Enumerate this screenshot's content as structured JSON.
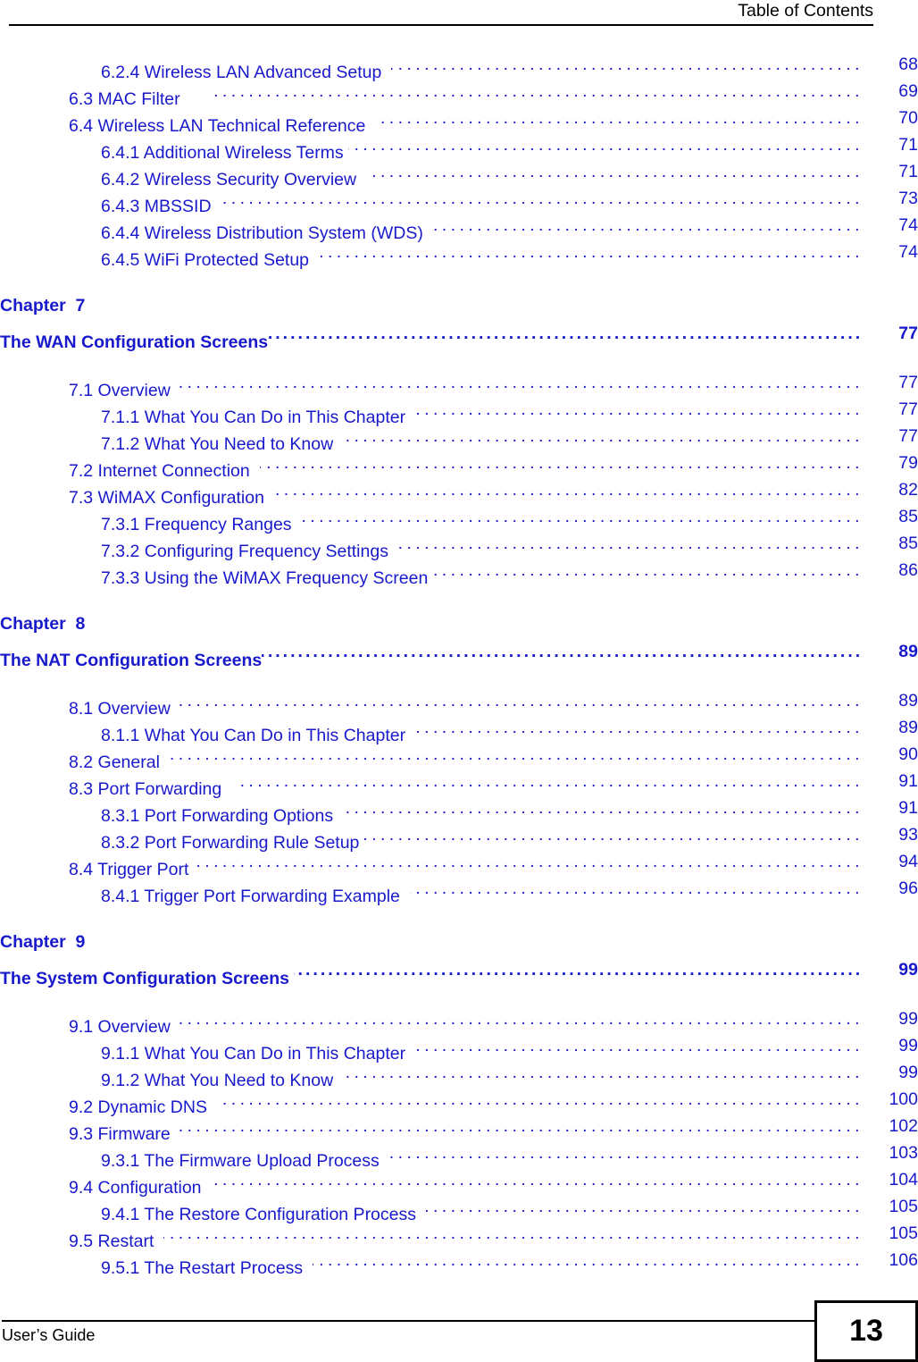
{
  "header": {
    "title": "Table of Contents"
  },
  "footer": {
    "left_text": "User’s Guide",
    "page_number": "13"
  },
  "colors": {
    "link_blue": "#1919cc",
    "text_black": "#000000",
    "page_background": "#ffffff"
  },
  "toc": {
    "groups": [
      {
        "type": "entries",
        "entries": [
          {
            "level": 3,
            "label": "6.2.4 Wireless LAN Advanced Setup  ",
            "page": "68"
          },
          {
            "level": 2,
            "label": "6.3 MAC Filter      ",
            "page": "69"
          },
          {
            "level": 2,
            "label": "6.4 Wireless LAN Technical Reference  ",
            "page": "70"
          },
          {
            "level": 3,
            "label": "6.4.1 Additional Wireless Terms ",
            "page": "71"
          },
          {
            "level": 3,
            "label": "6.4.2 Wireless Security Overview  ",
            "page": "71"
          },
          {
            "level": 3,
            "label": "6.4.3 MBSSID  ",
            "page": "73"
          },
          {
            "level": 3,
            "label": "6.4.4 Wireless Distribution System (WDS) ",
            "page": "74"
          },
          {
            "level": 3,
            "label": "6.4.5 WiFi Protected Setup  ",
            "page": "74"
          }
        ]
      },
      {
        "type": "chapter",
        "chapter_label": "Chapter  7",
        "chapter_title": "The WAN Configuration Screens",
        "chapter_page": "77",
        "entries": [
          {
            "level": 2,
            "label": "7.1 Overview ",
            "page": "77"
          },
          {
            "level": 3,
            "label": "7.1.1 What You Can Do in This Chapter  ",
            "page": "77"
          },
          {
            "level": 3,
            "label": "7.1.2 What You Need to Know  ",
            "page": "77"
          },
          {
            "level": 2,
            "label": "7.2 Internet Connection  ",
            "page": "79"
          },
          {
            "level": 2,
            "label": "7.3 WiMAX Configuration  ",
            "page": "82"
          },
          {
            "level": 3,
            "label": "7.3.1 Frequency Ranges ",
            "page": "85"
          },
          {
            "level": 3,
            "label": "7.3.2 Configuring Frequency Settings ",
            "page": "85"
          },
          {
            "level": 3,
            "label": "7.3.3 Using the WiMAX Frequency Screen ",
            "page": "86"
          }
        ]
      },
      {
        "type": "chapter",
        "chapter_label": "Chapter  8",
        "chapter_title": "The NAT Configuration Screens",
        "chapter_page": "89",
        "entries": [
          {
            "level": 2,
            "label": "8.1 Overview ",
            "page": "89"
          },
          {
            "level": 3,
            "label": "8.1.1 What You Can Do in This Chapter  ",
            "page": "89"
          },
          {
            "level": 2,
            "label": "8.2 General ",
            "page": "90"
          },
          {
            "level": 2,
            "label": "8.3 Port Forwarding   ",
            "page": "91"
          },
          {
            "level": 3,
            "label": "8.3.1 Port Forwarding Options  ",
            "page": "91"
          },
          {
            "level": 3,
            "label": "8.3.2 Port Forwarding Rule Setup ",
            "page": "93"
          },
          {
            "level": 2,
            "label": "8.4 Trigger Port ",
            "page": "94"
          },
          {
            "level": 3,
            "label": "8.4.1 Trigger Port Forwarding Example  ",
            "page": "96"
          }
        ]
      },
      {
        "type": "chapter",
        "chapter_label": "Chapter  9",
        "chapter_title": "The System Configuration Screens ",
        "chapter_page": "99",
        "entries": [
          {
            "level": 2,
            "label": "9.1 Overview ",
            "page": "99"
          },
          {
            "level": 3,
            "label": "9.1.1 What You Can Do in This Chapter  ",
            "page": "99"
          },
          {
            "level": 3,
            "label": "9.1.2 What You Need to Know  ",
            "page": "99"
          },
          {
            "level": 2,
            "label": "9.2 Dynamic DNS  ",
            "page": "100"
          },
          {
            "level": 2,
            "label": "9.3 Firmware ",
            "page": "102"
          },
          {
            "level": 3,
            "label": "9.3.1 The Firmware Upload Process ",
            "page": "103"
          },
          {
            "level": 2,
            "label": "9.4 Configuration  ",
            "page": "104"
          },
          {
            "level": 3,
            "label": "9.4.1 The Restore Configuration Process  ",
            "page": "105"
          },
          {
            "level": 2,
            "label": "9.5 Restart  ",
            "page": "105"
          },
          {
            "level": 3,
            "label": "9.5.1 The Restart Process  ",
            "page": "106"
          }
        ]
      }
    ]
  }
}
